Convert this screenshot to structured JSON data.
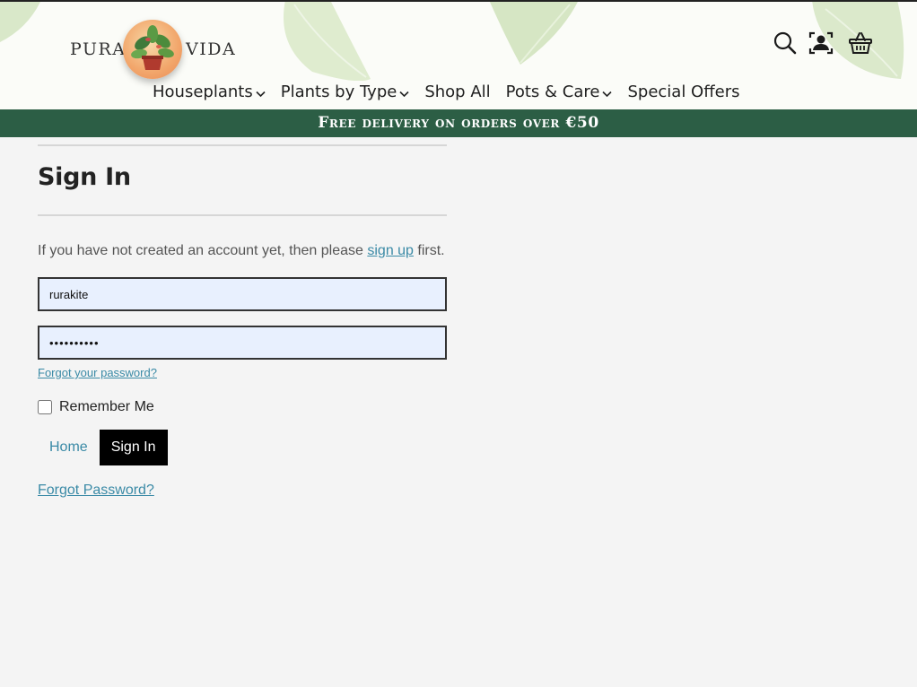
{
  "header": {
    "logo_left": "PURA",
    "logo_right": "VIDA",
    "icons": [
      "search-icon",
      "account-icon",
      "basket-icon"
    ]
  },
  "nav": {
    "items": [
      {
        "label": "Houseplants",
        "has_dropdown": true
      },
      {
        "label": "Plants by Type",
        "has_dropdown": true
      },
      {
        "label": "Shop All",
        "has_dropdown": false
      },
      {
        "label": "Pots & Care",
        "has_dropdown": true
      },
      {
        "label": "Special Offers",
        "has_dropdown": false
      }
    ]
  },
  "banner": {
    "text": "Free delivery on orders over €50"
  },
  "signin": {
    "title": "Sign In",
    "intro_before": "If you have not created an account yet, then please ",
    "intro_link": "sign up",
    "intro_after": " first.",
    "username_value": "rurakite",
    "password_value": "••••••••••",
    "forgot_small": "Forgot your password?",
    "remember_label": "Remember Me",
    "home_label": "Home",
    "signin_label": "Sign In",
    "forgot_large": "Forgot Password?"
  },
  "colors": {
    "banner_bg": "#2c5e45",
    "link": "#3a8aa6",
    "field_bg": "#e8f0fe",
    "page_bg": "#f4f4f4"
  }
}
